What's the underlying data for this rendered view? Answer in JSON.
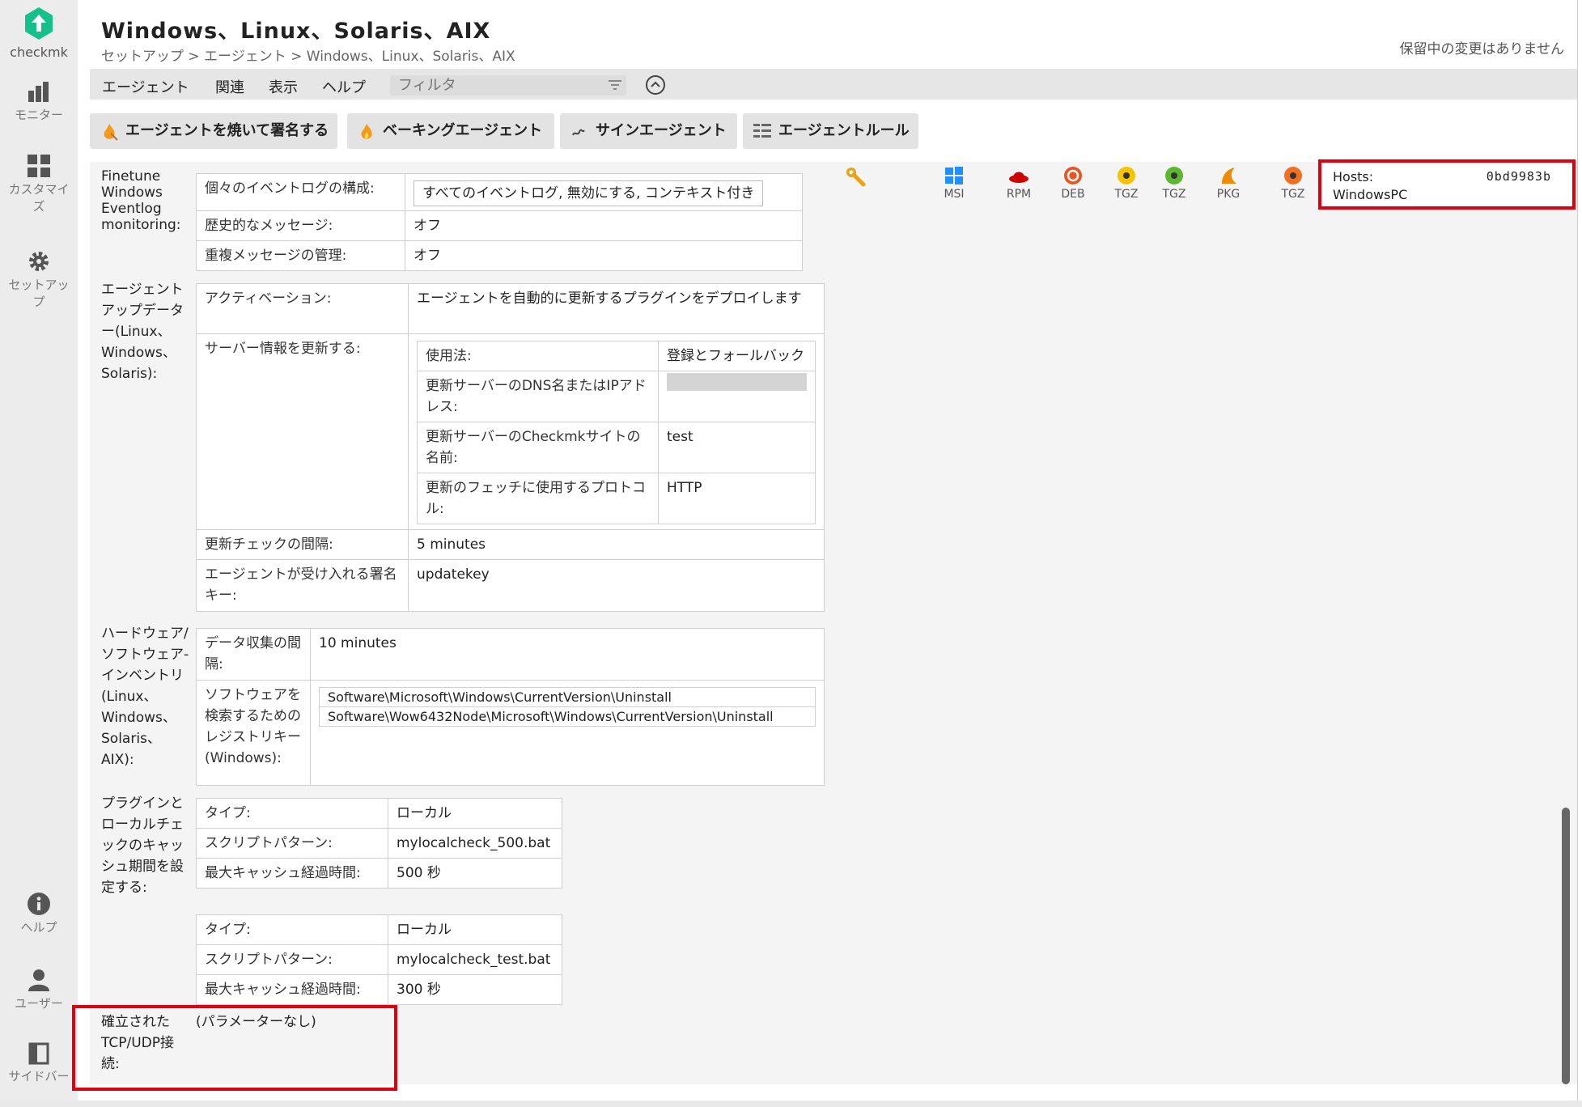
{
  "app": {
    "logo_text": "checkmk"
  },
  "sidebar": {
    "items": [
      {
        "label": "モニター",
        "icon": "bar-chart-icon"
      },
      {
        "label": "カスタマイズ",
        "icon": "grid-icon"
      },
      {
        "label": "セットアップ",
        "icon": "gear-icon"
      },
      {
        "label": "ヘルプ",
        "icon": "info-icon"
      },
      {
        "label": "ユーザー",
        "icon": "user-icon"
      },
      {
        "label": "サイドバー",
        "icon": "sidebar-icon"
      }
    ]
  },
  "header": {
    "title": "Windows、Linux、Solaris、AIX",
    "breadcrumb": "セットアップ > エージェント > Windows、Linux、Solaris、AIX",
    "pending": "保留中の変更はありません"
  },
  "menu": {
    "items": [
      "エージェント",
      "関連",
      "表示",
      "ヘルプ"
    ],
    "filter_placeholder": "フィルタ"
  },
  "toolbar": {
    "buttons": [
      {
        "label": "エージェントを焼いて署名する",
        "icon": "bake-sign-icon"
      },
      {
        "label": "ベーキングエージェント",
        "icon": "flame-icon"
      },
      {
        "label": "サインエージェント",
        "icon": "sign-icon"
      },
      {
        "label": "エージェントルール",
        "icon": "rules-icon"
      }
    ]
  },
  "packages": [
    "MSI",
    "RPM",
    "DEB",
    "TGZ",
    "TGZ",
    "PKG",
    "TGZ"
  ],
  "hosts": {
    "label": "Hosts:",
    "hash": "0bd9983b",
    "name": "WindowsPC"
  },
  "rules": {
    "eventlog": {
      "label": "Finetune Windows Eventlog monitoring:",
      "rows": [
        {
          "k": "個々のイベントログの構成:",
          "v": "すべてのイベントログ, 無効にする, コンテキスト付き"
        },
        {
          "k": "歴史的なメッセージ:",
          "v": "オフ"
        },
        {
          "k": "重複メッセージの管理:",
          "v": "オフ"
        }
      ]
    },
    "updater": {
      "label": "エージェントアップデーター(Linux、Windows、Solaris):",
      "activation_k": "アクティベーション:",
      "activation_v": "エージェントを自動的に更新するプラグインをデプロイします",
      "server_k": "サーバー情報を更新する:",
      "server_rows": [
        {
          "k": "使用法:",
          "v": "登録とフォールバック"
        },
        {
          "k": "更新サーバーのDNS名またはIPアドレス:",
          "v": ""
        },
        {
          "k": "更新サーバーのCheckmkサイトの名前:",
          "v": "test"
        },
        {
          "k": "更新のフェッチに使用するプロトコル:",
          "v": "HTTP"
        }
      ],
      "interval_k": "更新チェックの間隔:",
      "interval_v": "5 minutes",
      "key_k": "エージェントが受け入れる署名キー:",
      "key_v": "updatekey"
    },
    "inventory": {
      "label": "ハードウェア/ソフトウェア-インベントリ(Linux、Windows、Solaris、AIX):",
      "interval_k": "データ収集の間隔:",
      "interval_v": "10 minutes",
      "registry_k": "ソフトウェアを検索するためのレジストリキー(Windows):",
      "registry_v": [
        "Software\\Microsoft\\Windows\\CurrentVersion\\Uninstall",
        "Software\\Wow6432Node\\Microsoft\\Windows\\CurrentVersion\\Uninstall"
      ]
    },
    "cache": {
      "label": "プラグインとローカルチェックのキャッシュ期間を設定する:",
      "tables": [
        {
          "type_k": "タイプ:",
          "type_v": "ローカル",
          "pattern_k": "スクリプトパターン:",
          "pattern_v": "mylocalcheck_500.bat",
          "age_k": "最大キャッシュ経過時間:",
          "age_v": "500 秒"
        },
        {
          "type_k": "タイプ:",
          "type_v": "ローカル",
          "pattern_k": "スクリプトパターン:",
          "pattern_v": "mylocalcheck_test.bat",
          "age_k": "最大キャッシュ経過時間:",
          "age_v": "300 秒"
        }
      ]
    },
    "tcp": {
      "label": "確立されたTCP/UDP接続:",
      "value": "(パラメーターなし)"
    }
  },
  "colors": {
    "highlight": "#e0000e",
    "brand": "#15d1a0"
  }
}
